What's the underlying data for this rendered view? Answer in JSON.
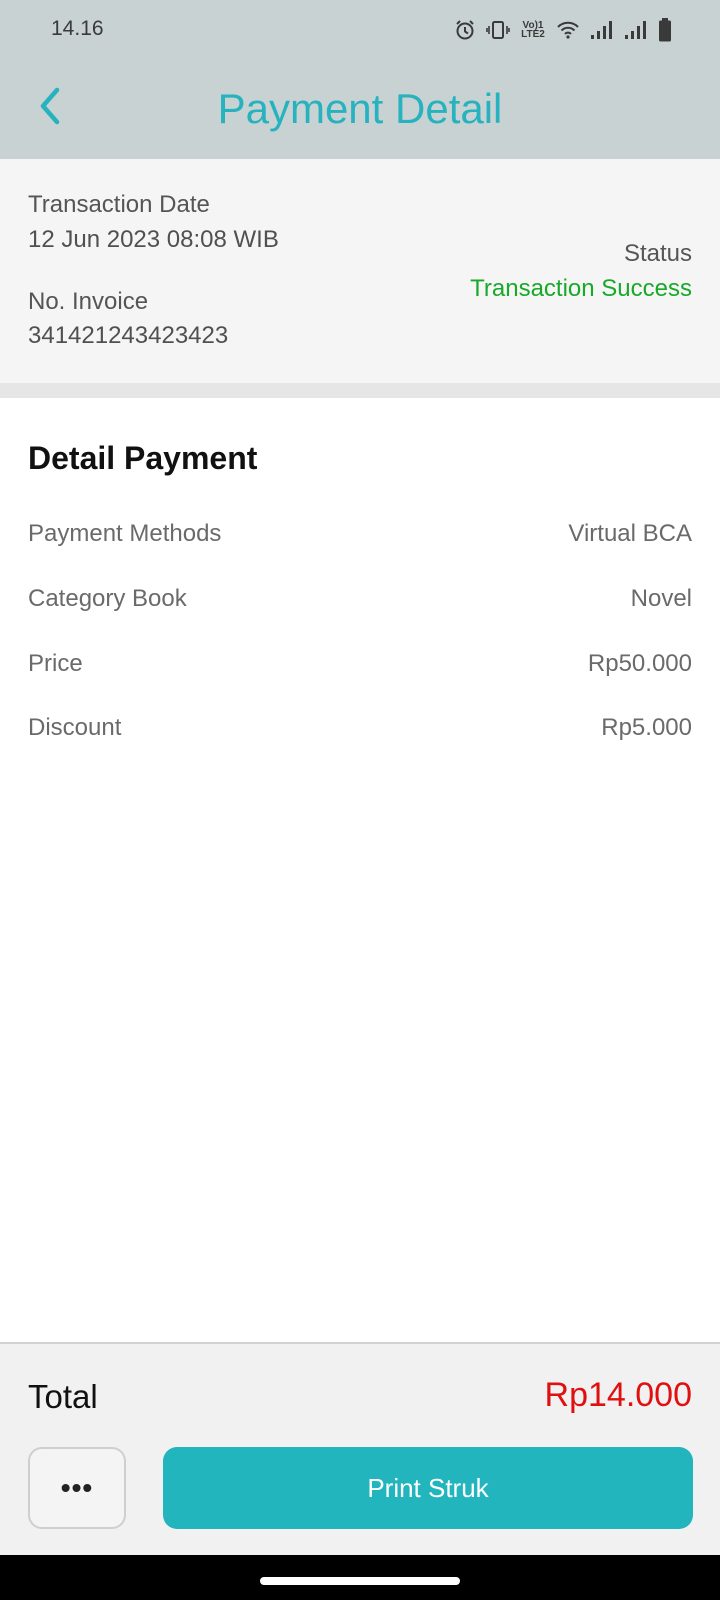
{
  "status_bar": {
    "time": "14.16",
    "icons": [
      "alarm-icon",
      "vibrate-icon",
      "volte-lte2-icon",
      "wifi-icon",
      "signal-sim1-icon",
      "signal-sim2-icon",
      "battery-icon"
    ],
    "volte_line1": "Vo)1",
    "volte_line2": "LTE2"
  },
  "header": {
    "back_icon": "chevron-left-icon",
    "title": "Payment Detail"
  },
  "transaction": {
    "date_label": "Transaction Date",
    "date_value": "12 Jun 2023 08:08 WIB",
    "invoice_label": "No. Invoice",
    "invoice_value": "341421243423423",
    "status_label": "Status",
    "status_value": "Transaction Success"
  },
  "detail": {
    "title": "Detail Payment",
    "rows": [
      {
        "label": "Payment Methods",
        "value": "Virtual BCA"
      },
      {
        "label": "Category Book",
        "value": "Novel"
      },
      {
        "label": "Price",
        "value": "Rp50.000"
      },
      {
        "label": "Discount",
        "value": "Rp5.000"
      }
    ]
  },
  "footer": {
    "total_label": "Total",
    "total_value": "Rp14.000",
    "more_label": "•••",
    "print_label": "Print Struk"
  },
  "colors": {
    "accent": "#26b2be",
    "success": "#18a82a",
    "total": "#e01010",
    "app_bar": "#c8d2d2"
  }
}
